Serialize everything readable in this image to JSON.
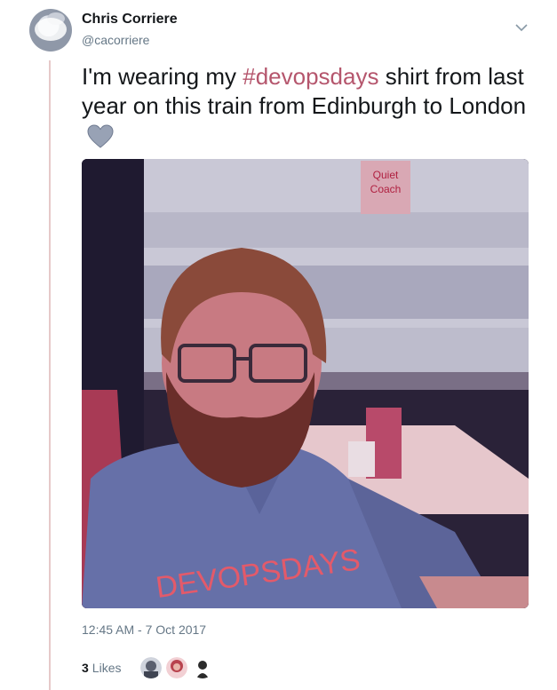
{
  "tweet": {
    "user_name": "Chris Corriere",
    "user_handle": "@cacorriere",
    "text_before": "I'm wearing my ",
    "hashtag": "#devopsdays",
    "text_after": " shirt from last year on this train from Edinburgh to London",
    "emoji": "grey-heart",
    "timestamp": "12:45 AM - 7 Oct 2017",
    "likes_count": "3",
    "likes_label": "Likes"
  },
  "photo": {
    "sign_text": "Quiet Coach",
    "shirt_text": "DEVOPSDAYS"
  },
  "colors": {
    "hashtag": "#b5566d",
    "secondary_text": "#657786",
    "thread_line": "#e6c9c9"
  },
  "icons": {
    "menu": "chevron-down-icon",
    "heart": "grey-heart-icon"
  }
}
